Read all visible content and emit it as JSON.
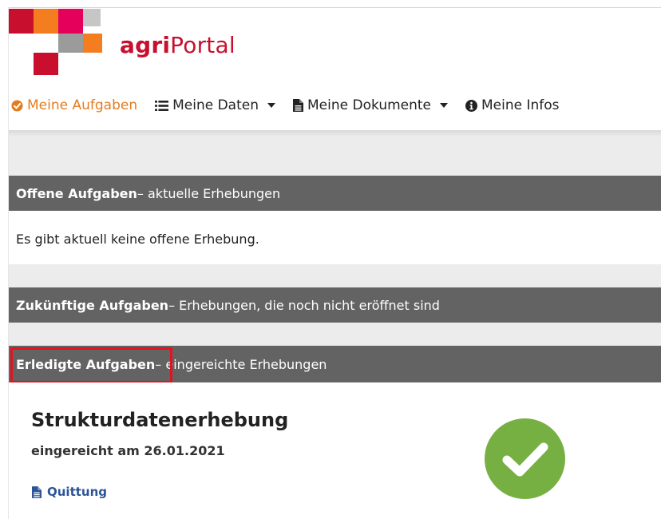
{
  "logo": {
    "text_bold": "agri",
    "text_regular": "Portal",
    "colors": {
      "red": "#c8102e",
      "orange": "#f47d20",
      "magenta": "#e5005b",
      "gray": "#9b9b9b",
      "lightgray": "#c6c6c6"
    }
  },
  "nav": {
    "items": [
      {
        "label": "Meine Aufgaben",
        "icon": "check-circle-icon"
      },
      {
        "label": "Meine Daten",
        "icon": "list-icon"
      },
      {
        "label": "Meine Dokumente",
        "icon": "document-icon"
      },
      {
        "label": "Meine Infos",
        "icon": "info-icon"
      }
    ],
    "active_color": "#e37c20"
  },
  "sections": {
    "open": {
      "title": "Offene Aufgaben",
      "subtitle": " – aktuelle Erhebungen",
      "message": "Es gibt aktuell keine offene Erhebung."
    },
    "future": {
      "title": "Zukünftige Aufgaben",
      "subtitle": " – Erhebungen, die noch nicht eröffnet sind"
    },
    "done": {
      "title": "Erledigte Aufgaben",
      "subtitle": " – eingereichte Erhebungen"
    }
  },
  "completed_item": {
    "title": "Strukturdatenerhebung",
    "submitted": "eingereicht am 26.01.2021",
    "receipt_label": "Quittung",
    "status_icon": "check-mark-icon",
    "status_color": "#76b043"
  },
  "colors": {
    "bar": "#636363",
    "highlight": "#e2131f",
    "link": "#2c5597"
  }
}
